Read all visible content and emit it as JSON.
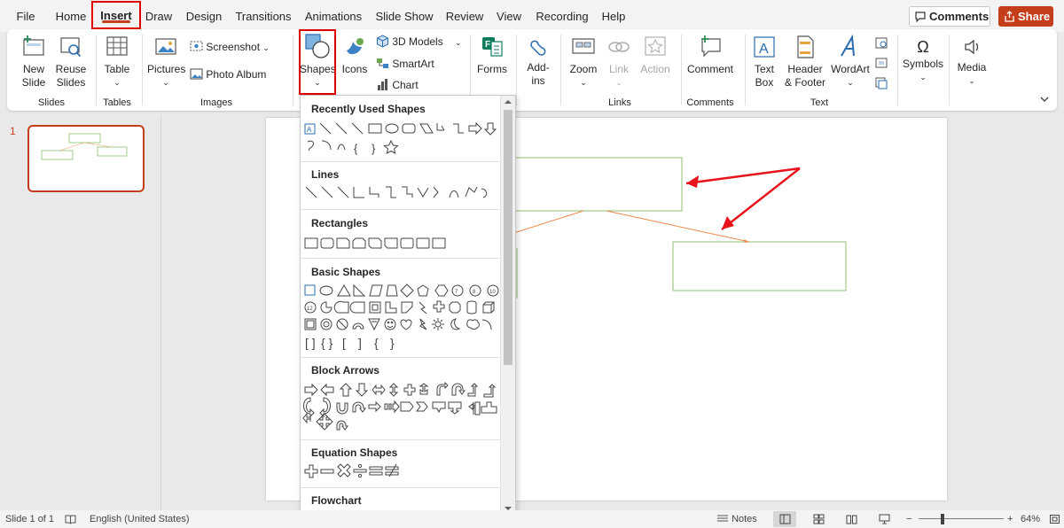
{
  "menu": {
    "tabs": [
      {
        "label": "File"
      },
      {
        "label": "Home"
      },
      {
        "label": "Insert"
      },
      {
        "label": "Draw"
      },
      {
        "label": "Design"
      },
      {
        "label": "Transitions"
      },
      {
        "label": "Animations"
      },
      {
        "label": "Slide Show"
      },
      {
        "label": "Review"
      },
      {
        "label": "View"
      },
      {
        "label": "Recording"
      },
      {
        "label": "Help"
      }
    ],
    "active_tab": "Insert",
    "comments_label": "Comments",
    "share_label": "Share"
  },
  "ribbon": {
    "new_slide": "New Slide",
    "reuse_slides": "Reuse Slides",
    "slides_group": "Slides",
    "table": "Table",
    "tables_group": "Tables",
    "pictures": "Pictures",
    "screenshot": "Screenshot",
    "photo_album": "Photo Album",
    "images_group": "Images",
    "shapes": "Shapes",
    "icons": "Icons",
    "models_3d": "3D Models",
    "smartart": "SmartArt",
    "chart": "Chart",
    "forms": "Forms",
    "addins": "Add-ins",
    "zoom": "Zoom",
    "link": "Link",
    "action": "Action",
    "links_group": "Links",
    "comment": "Comment",
    "comments_group": "Comments",
    "text_box": "Text Box",
    "header_footer": "Header & Footer",
    "wordart": "WordArt",
    "text_group": "Text",
    "symbols": "Symbols",
    "media": "Media"
  },
  "thumbnail": {
    "number": "1"
  },
  "shapes_dropdown": {
    "sections": [
      "Recently Used Shapes",
      "Lines",
      "Rectangles",
      "Basic Shapes",
      "Block Arrows",
      "Equation Shapes",
      "Flowchart"
    ]
  },
  "statusbar": {
    "slide_info": "Slide 1 of 1",
    "language": "English (United States)",
    "notes": "Notes",
    "zoom": "64%"
  },
  "colors": {
    "accent": "#c43e1c",
    "highlight": "#e00000",
    "shape_outline": "#8cc06e",
    "connector": "#f08a4b",
    "annotation_arrow": "#e8121b"
  }
}
